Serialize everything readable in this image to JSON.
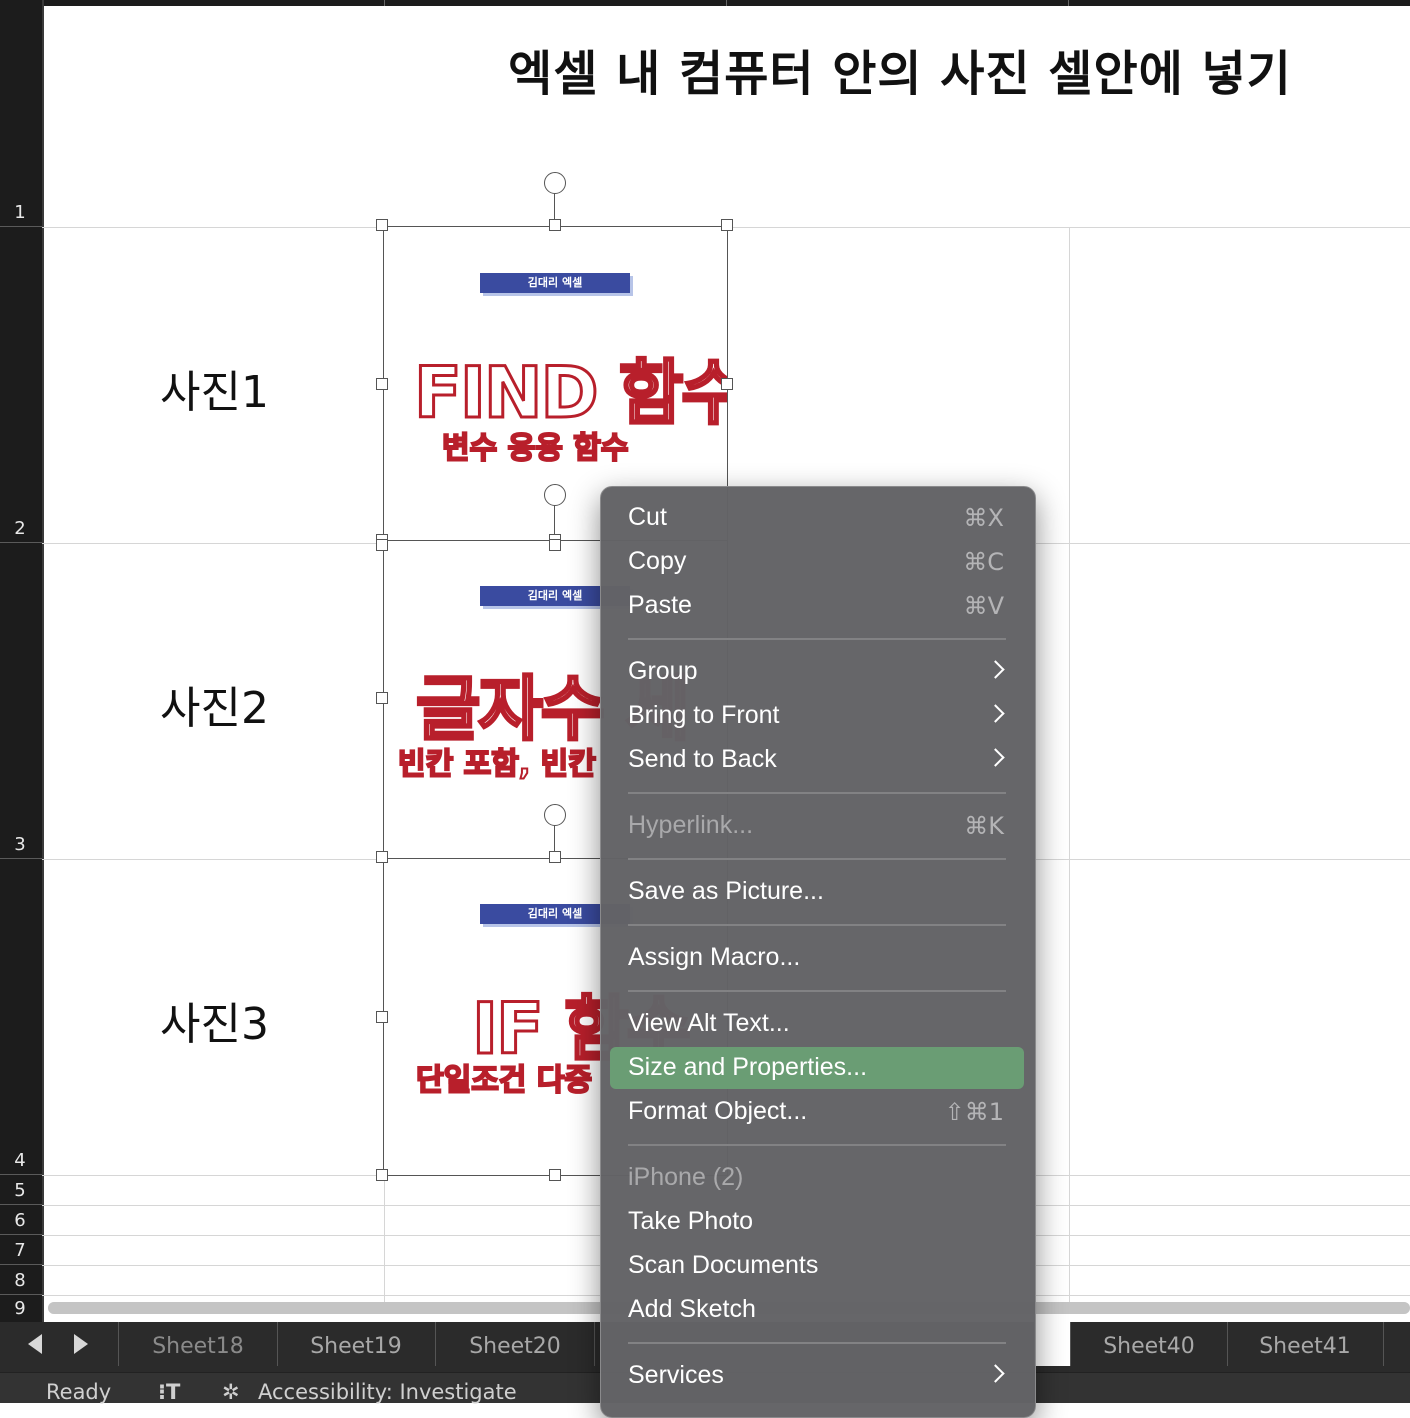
{
  "title": "엑셀 내 컴퓨터 안의 사진 셀안에 넣기",
  "rows": [
    "1",
    "2",
    "3",
    "4",
    "5",
    "6",
    "7",
    "8",
    "9"
  ],
  "row_labels": [
    "사진1",
    "사진2",
    "사진3"
  ],
  "pictures": [
    {
      "badge": "김대리 엑셀",
      "main": "FIND  함수",
      "sub": "변수 응용 함수"
    },
    {
      "badge": "김대리 엑셀",
      "main": "글자수 세",
      "sub": "빈칸 포함, 빈칸"
    },
    {
      "badge": "김대리 엑셀",
      "main": "IF 함수",
      "sub": "단일조건 다중"
    }
  ],
  "context_menu": {
    "items": [
      {
        "label": "Cut",
        "shortcut": "⌘X"
      },
      {
        "label": "Copy",
        "shortcut": "⌘C"
      },
      {
        "label": "Paste",
        "shortcut": "⌘V"
      },
      {
        "label": "Group",
        "submenu": true
      },
      {
        "label": "Bring to Front",
        "submenu": true
      },
      {
        "label": "Send to Back",
        "submenu": true
      },
      {
        "label": "Hyperlink...",
        "shortcut": "⌘K",
        "disabled": true
      },
      {
        "label": "Save as Picture..."
      },
      {
        "label": "Assign Macro..."
      },
      {
        "label": "View Alt Text..."
      },
      {
        "label": "Size and Properties...",
        "highlighted": true
      },
      {
        "label": "Format Object...",
        "shortcut": "⇧⌘1"
      },
      {
        "label": "iPhone (2)",
        "disabled": true
      },
      {
        "label": "Take Photo"
      },
      {
        "label": "Scan Documents"
      },
      {
        "label": "Add Sketch"
      },
      {
        "label": "Services",
        "submenu": true
      }
    ]
  },
  "sheet_tabs": [
    "Sheet18",
    "Sheet19",
    "Sheet20",
    "Sheet40",
    "Sheet41"
  ],
  "status": {
    "ready": "Ready",
    "accessibility": "Accessibility: Investigate"
  },
  "colors": {
    "highlight": "#6a9d74",
    "badge": "#3a4ba0",
    "title_red": "#b81f2b"
  }
}
